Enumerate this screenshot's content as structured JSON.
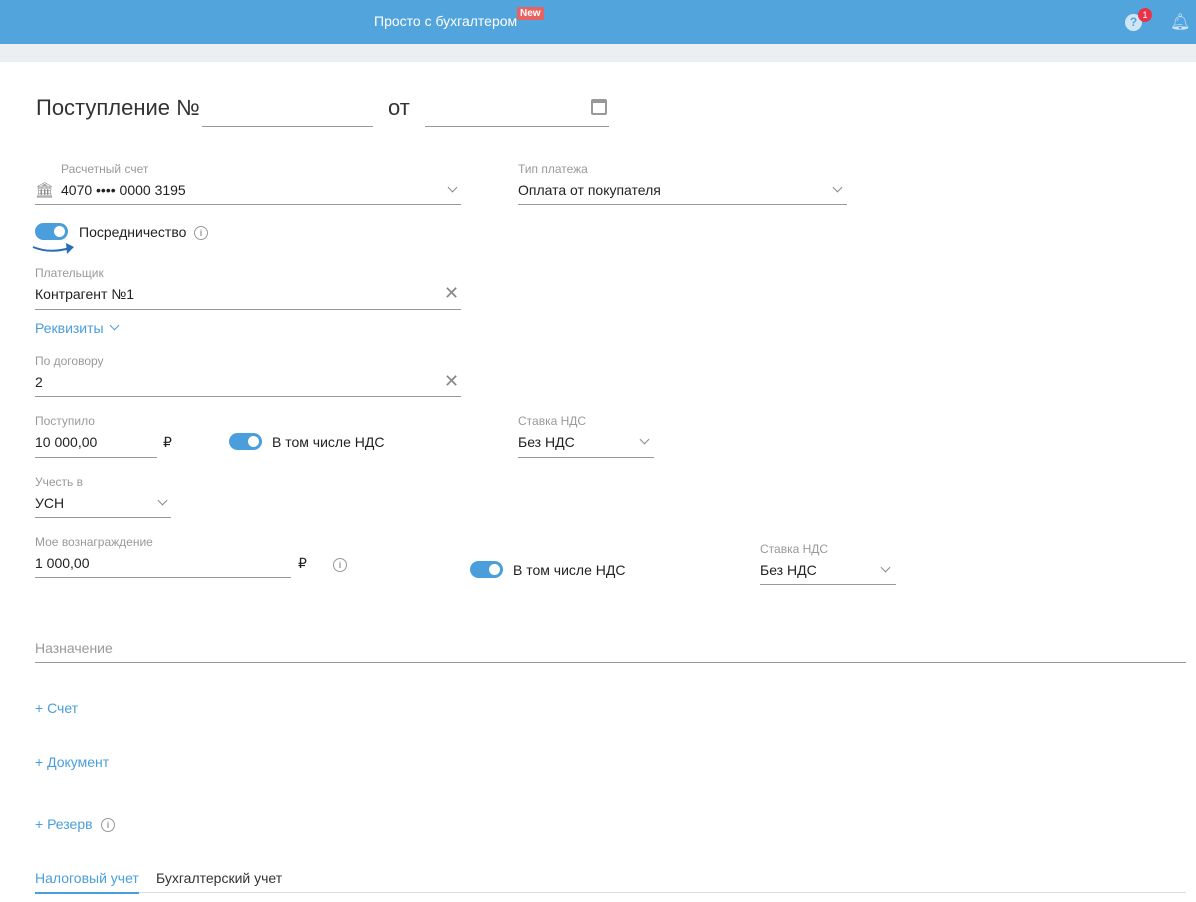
{
  "header": {
    "title": "Просто с бухгалтером",
    "new_badge": "New",
    "help_badge": "1",
    "help_icon": "?"
  },
  "form": {
    "title": "Поступление №",
    "from": "от",
    "number": "",
    "date": "",
    "account": {
      "label": "Расчетный счет",
      "value": "4070 •••• 0000 3195"
    },
    "payment_type": {
      "label": "Тип платежа",
      "value": "Оплата от покупателя"
    },
    "mediation": {
      "label": "Посредничество",
      "on": true
    },
    "payer": {
      "label": "Плательщик",
      "value": "Контрагент №1"
    },
    "requisites": "Реквизиты",
    "contract": {
      "label": "По договору",
      "value": "2"
    },
    "received": {
      "label": "Поступило",
      "value": "10 000,00",
      "currency": "₽"
    },
    "incl_vat1": {
      "label": "В том числе НДС",
      "on": true
    },
    "vat_rate1": {
      "label": "Ставка НДС",
      "value": "Без НДС"
    },
    "account_in": {
      "label": "Учесть в",
      "value": "УСН"
    },
    "reward": {
      "label": "Мое вознаграждение",
      "value": "1 000,00",
      "currency": "₽"
    },
    "incl_vat2": {
      "label": "В том числе НДС",
      "on": true
    },
    "vat_rate2": {
      "label": "Ставка НДС",
      "value": "Без НДС"
    },
    "purpose": {
      "placeholder": "Назначение"
    },
    "add_invoice": "+ Счет",
    "add_document": "+ Документ",
    "add_reserve": "+ Резерв"
  },
  "tabs": [
    {
      "label": "Налоговый учет",
      "active": true
    },
    {
      "label": "Бухгалтерский учет",
      "active": false
    }
  ]
}
